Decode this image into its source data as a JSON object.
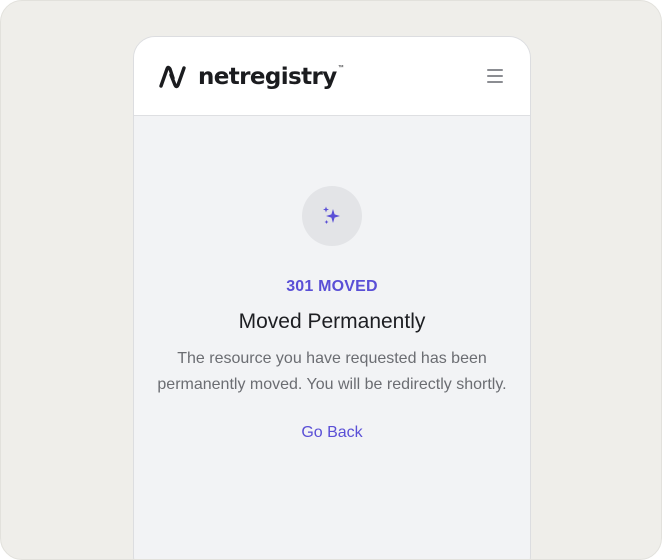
{
  "header": {
    "brand": "netregistry",
    "brand_tm": "™",
    "menu_icon": "hamburger-menu-icon"
  },
  "error": {
    "icon": "sparkles-icon",
    "code": "301 MOVED",
    "title": "Moved Permanently",
    "message": "The resource you have requested has been permanently moved. You will be redirectly shortly.",
    "back_label": "Go Back"
  },
  "colors": {
    "accent": "#5a4fd6",
    "background": "#f2f3f5",
    "outer_background": "#efeeea",
    "text": "#1d1e22",
    "muted_text": "#6b6d72"
  }
}
